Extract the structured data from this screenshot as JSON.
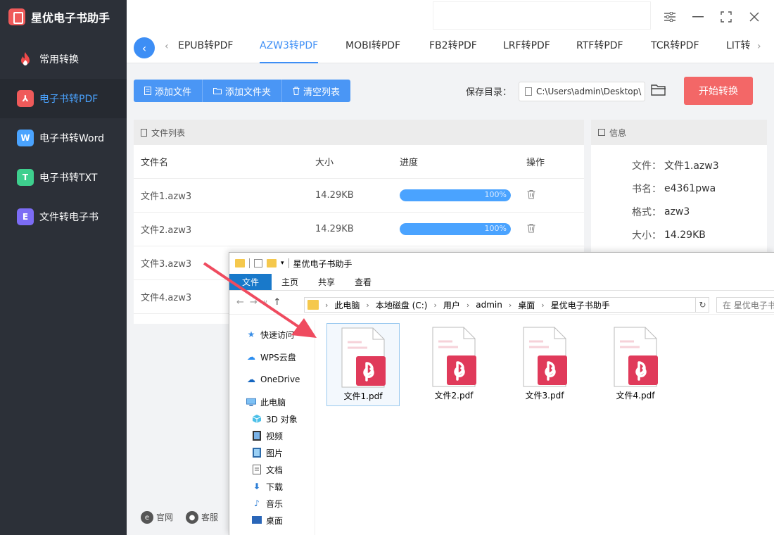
{
  "app": {
    "title": "星优电子书助手"
  },
  "sidebar": {
    "items": [
      {
        "label": "常用转换",
        "icon": "fire-icon"
      },
      {
        "label": "电子书转PDF",
        "icon": "pdf-icon",
        "badge": "⅄",
        "active": true
      },
      {
        "label": "电子书转Word",
        "icon": "word-icon",
        "badge": "W"
      },
      {
        "label": "电子书转TXT",
        "icon": "txt-icon",
        "badge": "T"
      },
      {
        "label": "文件转电子书",
        "icon": "ebook-icon",
        "badge": "E"
      }
    ]
  },
  "tabs": {
    "items": [
      "EPUB转PDF",
      "AZW3转PDF",
      "MOBI转PDF",
      "FB2转PDF",
      "LRF转PDF",
      "RTF转PDF",
      "TCR转PDF",
      "LIT转"
    ],
    "active_index": 1
  },
  "toolbar": {
    "add_file": "添加文件",
    "add_folder": "添加文件夹",
    "clear_list": "清空列表",
    "save_label": "保存目录：",
    "save_path": "C:\\Users\\admin\\Desktop\\",
    "start": "开始转换"
  },
  "file_list": {
    "title": "文件列表",
    "headers": {
      "name": "文件名",
      "size": "大小",
      "progress": "进度",
      "action": "操作"
    },
    "rows": [
      {
        "name": "文件1.azw3",
        "size": "14.29KB",
        "progress": "100%",
        "progress_value": 1.0
      },
      {
        "name": "文件2.azw3",
        "size": "14.29KB",
        "progress": "100%",
        "progress_value": 1.0
      },
      {
        "name": "文件3.azw3"
      },
      {
        "name": "文件4.azw3"
      }
    ]
  },
  "info": {
    "title": "信息",
    "rows": [
      {
        "key": "文件：",
        "value": "文件1.azw3"
      },
      {
        "key": "书名：",
        "value": "e4361pwa"
      },
      {
        "key": "格式：",
        "value": "azw3"
      },
      {
        "key": "大小：",
        "value": "14.29KB"
      }
    ]
  },
  "footer": {
    "website": "官网",
    "service": "客服"
  },
  "explorer": {
    "title": "星优电子书助手",
    "ribbon": [
      "文件",
      "主页",
      "共享",
      "查看"
    ],
    "breadcrumb": [
      "此电脑",
      "本地磁盘 (C:)",
      "用户",
      "admin",
      "桌面",
      "星优电子书助手"
    ],
    "search_placeholder": "在 星优电子书助手",
    "nav": [
      {
        "label": "快速访问",
        "icon": "star-icon"
      },
      {
        "label": "WPS云盘",
        "icon": "cloud-icon"
      },
      {
        "label": "OneDrive",
        "icon": "onedrive-icon"
      },
      {
        "label": "此电脑",
        "icon": "computer-icon"
      },
      {
        "label": "3D 对象",
        "icon": "cube-icon"
      },
      {
        "label": "视频",
        "icon": "video-icon"
      },
      {
        "label": "图片",
        "icon": "picture-icon"
      },
      {
        "label": "文档",
        "icon": "document-icon"
      },
      {
        "label": "下载",
        "icon": "download-icon"
      },
      {
        "label": "音乐",
        "icon": "music-icon"
      },
      {
        "label": "桌面",
        "icon": "desktop-icon"
      }
    ],
    "files": [
      "文件1.pdf",
      "文件2.pdf",
      "文件3.pdf",
      "文件4.pdf"
    ]
  },
  "colors": {
    "accent": "#3d8ef5",
    "start": "#f36767",
    "sidebar": "#2c3038",
    "pdf": "#e03a5a"
  }
}
